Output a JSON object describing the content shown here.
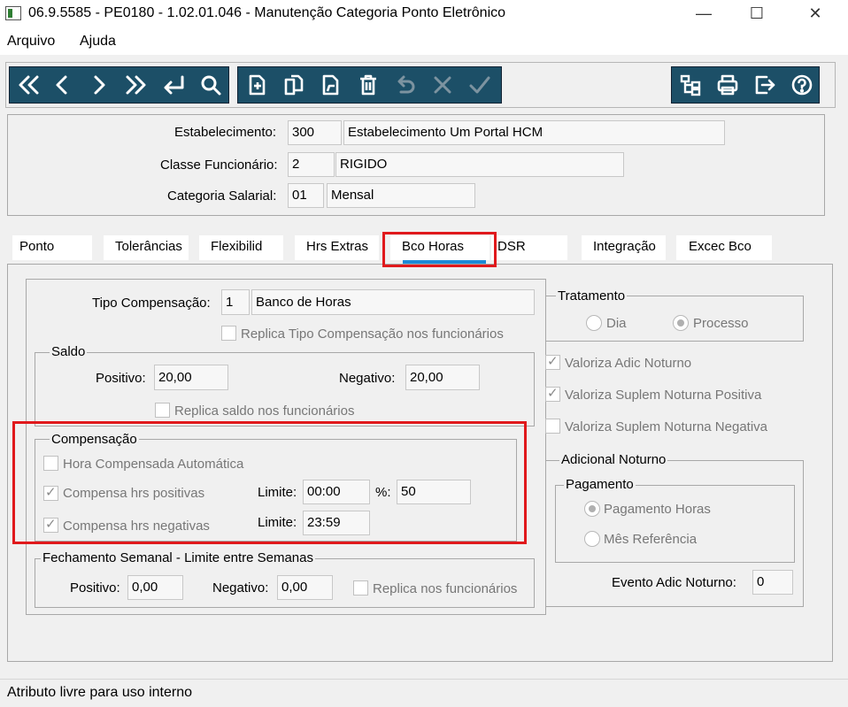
{
  "window": {
    "title": "06.9.5585 - PE0180 - 1.02.01.046 - Manutenção Categoria Ponto Eletrônico",
    "min": "—",
    "max": "☐",
    "close": "✕"
  },
  "menu": [
    "Arquivo",
    "Ajuda"
  ],
  "toolbar": {
    "nav_icons": [
      "first-record-icon",
      "previous-record-icon",
      "next-record-icon",
      "last-record-icon",
      "goto-icon",
      "search-icon"
    ],
    "edit_icons": [
      "new-record-icon",
      "copy-record-icon",
      "edit-record-icon",
      "delete-record-icon",
      "undo-icon",
      "cancel-icon",
      "confirm-icon"
    ],
    "right_icons": [
      "hierarchy-icon",
      "print-icon",
      "exit-icon",
      "help-icon"
    ],
    "color": "#1c4f67"
  },
  "header": {
    "estabelecimento_label": "Estabelecimento:",
    "estabelecimento_code": "300",
    "estabelecimento_name": "Estabelecimento Um Portal HCM",
    "classe_label": "Classe Funcionário:",
    "classe_code": "2",
    "classe_name": "RIGIDO",
    "categoria_label": "Categoria Salarial:",
    "categoria_code": "01",
    "categoria_name": "Mensal"
  },
  "tabs": [
    "Ponto",
    "Tolerâncias",
    "Flexibilid",
    "Hrs Extras",
    "Bco Horas",
    "DSR",
    "Integração",
    "Excec Bco"
  ],
  "active_tab": "Bco Horas",
  "bco_horas": {
    "tipo_label": "Tipo Compensação:",
    "tipo_code": "1",
    "tipo_name": "Banco de Horas",
    "replica_tipo": "Replica Tipo Compensação nos funcionários",
    "saldo": {
      "title": "Saldo",
      "positivo_label": "Positivo:",
      "positivo": "20,00",
      "negativo_label": "Negativo:",
      "negativo": "20,00",
      "replica": "Replica saldo nos funcionários"
    },
    "compensacao": {
      "title": "Compensação",
      "hora_auto": "Hora Compensada Automática",
      "hrs_positivas": "Compensa hrs positivas",
      "hrs_negativas": "Compensa hrs negativas",
      "limite_label": "Limite:",
      "limite_pos": "00:00",
      "pct_label": "%:",
      "pct": "50",
      "limite_neg": "23:59"
    },
    "fechamento": {
      "title": "Fechamento Semanal - Limite entre Semanas",
      "positivo_label": "Positivo:",
      "positivo": "0,00",
      "negativo_label": "Negativo:",
      "negativo": "0,00",
      "replica": "Replica nos funcionários"
    },
    "tratamento": {
      "title": "Tratamento",
      "dia": "Dia",
      "processo": "Processo"
    },
    "valoriza_adic": "Valoriza Adic Noturno",
    "valoriza_pos": "Valoriza Suplem Noturna Positiva",
    "valoriza_neg": "Valoriza Suplem Noturna Negativa",
    "adicional": {
      "title": "Adicional Noturno",
      "pagamento_title": "Pagamento",
      "pagamento_horas": "Pagamento Horas",
      "mes_referencia": "Mês Referência",
      "evento_label": "Evento Adic Noturno:",
      "evento": "0"
    }
  },
  "status": "Atributo livre para uso interno",
  "colors": {
    "highlight": "#e0191c",
    "tab_underline": "#1e8ad6"
  }
}
